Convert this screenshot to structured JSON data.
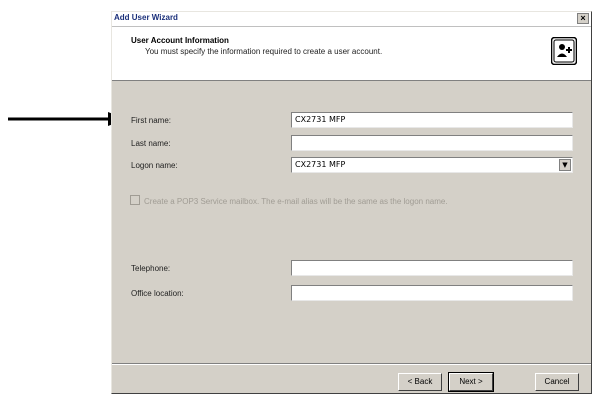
{
  "window": {
    "title": "Add User Wizard",
    "close_label": "×"
  },
  "header": {
    "title": "User Account Information",
    "subtitle": "You must specify the information required to create a user account."
  },
  "form": {
    "first_name": {
      "label": "First name:",
      "value": "CX2731 MFP"
    },
    "last_name": {
      "label": "Last name:",
      "value": ""
    },
    "logon_name": {
      "label": "Logon name:",
      "value": "CX2731 MFP"
    },
    "pop3_checkbox": {
      "label": "Create a POP3 Service mailbox.  The e-mail alias will be the same as the logon name.",
      "checked": false
    },
    "telephone": {
      "label": "Telephone:",
      "value": ""
    },
    "office_location": {
      "label": "Office location:",
      "value": ""
    }
  },
  "buttons": {
    "back": "< Back",
    "next": "Next >",
    "cancel": "Cancel"
  },
  "icons": {
    "header_icon": "user-wizard-icon",
    "pointer": "arrow-right-icon"
  }
}
